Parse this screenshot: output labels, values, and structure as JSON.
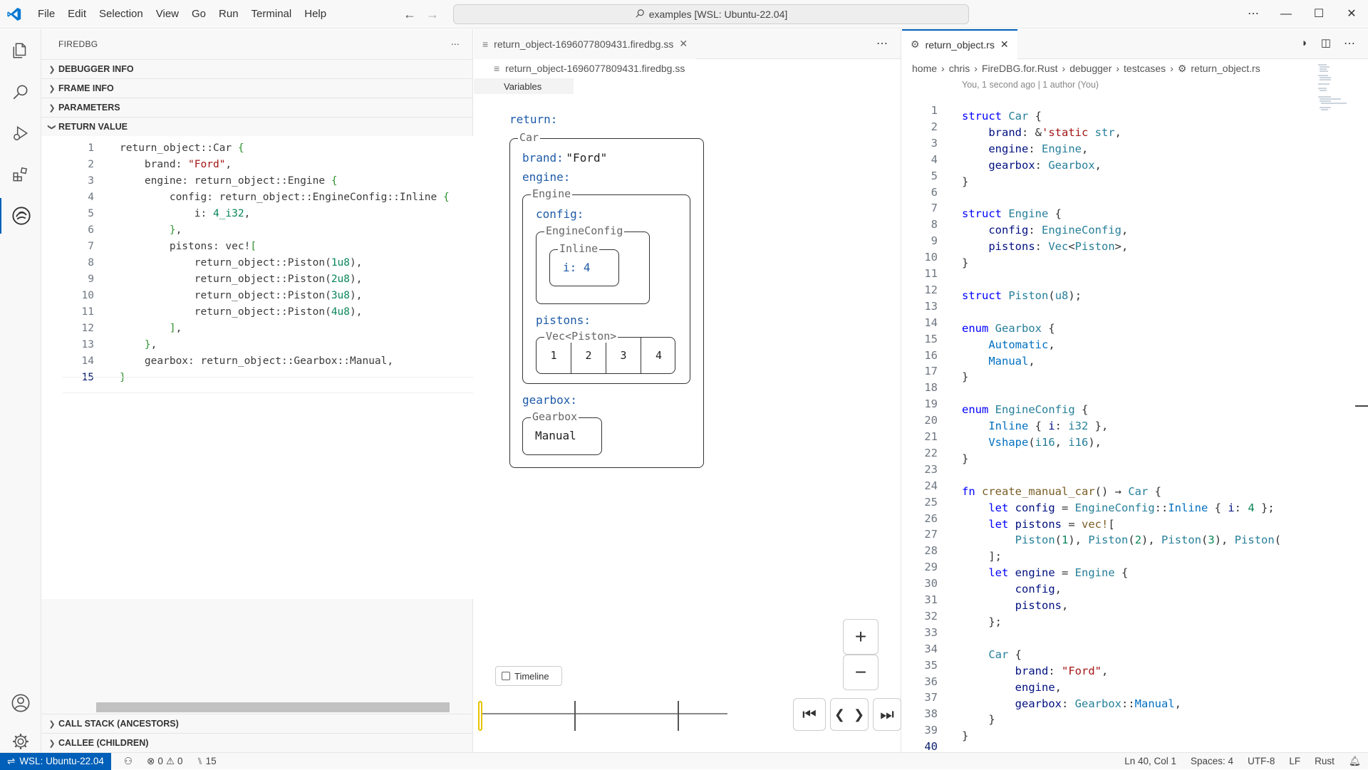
{
  "titlebar": {
    "menu": [
      "File",
      "Edit",
      "Selection",
      "View",
      "Go",
      "Run",
      "Terminal",
      "Help"
    ],
    "command_center": "examples [WSL: Ubuntu-22.04]"
  },
  "sidebar": {
    "title": "FIREDBG",
    "sections_top": [
      "DEBUGGER INFO",
      "FRAME INFO",
      "PARAMETERS",
      "RETURN VALUE"
    ],
    "sections_bottom": [
      "CALL STACK (ANCESTORS)",
      "CALLEE (CHILDREN)"
    ],
    "return_value_lines": [
      "return_object::Car {",
      "    brand: \"Ford\",",
      "    engine: return_object::Engine {",
      "        config: return_object::EngineConfig::Inline {",
      "            i: 4_i32,",
      "        },",
      "        pistons: vec![",
      "            return_object::Piston(1u8),",
      "            return_object::Piston(2u8),",
      "            return_object::Piston(3u8),",
      "            return_object::Piston(4u8),",
      "        ],",
      "    },",
      "    gearbox: return_object::Gearbox::Manual,",
      "}"
    ]
  },
  "editor1": {
    "tab_label": "return_object-1696077809431.firedbg.ss",
    "breadcrumb": "return_object-1696077809431.firedbg.ss",
    "subheader": "Variables",
    "viz": {
      "return_label": "return:",
      "car_caption": "Car",
      "brand_label": "brand:",
      "brand_value": "\"Ford\"",
      "engine_label": "engine:",
      "engine_caption": "Engine",
      "config_label": "config:",
      "engineconfig_caption": "EngineConfig",
      "inline_caption": "Inline",
      "inline_field": "i: 4",
      "pistons_label": "pistons:",
      "vec_caption": "Vec<Piston>",
      "pistons": [
        "1",
        "2",
        "3",
        "4"
      ],
      "gearbox_label": "gearbox:",
      "gearbox_caption": "Gearbox",
      "gearbox_value": "Manual"
    },
    "zoom_in": "+",
    "zoom_out": "−",
    "timeline_label": "Timeline"
  },
  "editor2": {
    "tab_label": "return_object.rs",
    "breadcrumb": [
      "home",
      "chris",
      "FireDBG.for.Rust",
      "debugger",
      "testcases",
      "return_object.rs"
    ],
    "blame": "You, 1 second ago | 1 author (You)",
    "line_count": 40
  },
  "statusbar": {
    "remote": "WSL: Ubuntu-22.04",
    "errors": "0",
    "warnings": "0",
    "ports": "15",
    "position": "Ln 40, Col 1",
    "spaces": "Spaces: 4",
    "encoding": "UTF-8",
    "eol": "LF",
    "language": "Rust"
  },
  "colors": {
    "accent": "#005fb8",
    "keyword": "#0000ff",
    "type": "#267f99",
    "string": "#a31515"
  }
}
